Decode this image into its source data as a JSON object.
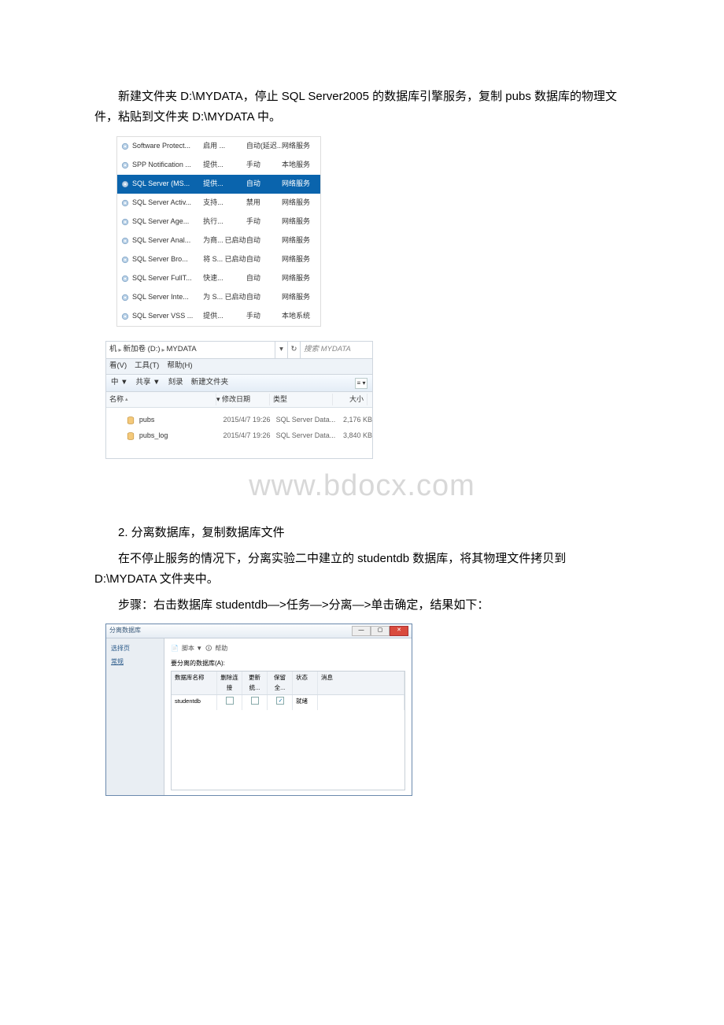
{
  "paragraphs": {
    "p1": "新建文件夹 D:\\MYDATA，停止 SQL Server2005 的数据库引擎服务，复制 pubs 数据库的物理文件，粘贴到文件夹 D:\\MYDATA 中。",
    "p2": "2. 分离数据库，复制数据库文件",
    "p3": "在不停止服务的情况下，分离实验二中建立的 studentdb 数据库，将其物理文件拷贝到 D:\\MYDATA 文件夹中。",
    "p4": "步骤：右击数据库 studentdb—>任务—>分离—>单击确定，结果如下："
  },
  "watermark": "www.bdocx.com",
  "services": [
    {
      "name": "Software Protect...",
      "desc": "启用 ...",
      "status": "",
      "startup": "自动(延迟...",
      "logon": "网络服务",
      "sel": false
    },
    {
      "name": "SPP Notification ...",
      "desc": "提供...",
      "status": "",
      "startup": "手动",
      "logon": "本地服务",
      "sel": false
    },
    {
      "name": "SQL Server (MS...",
      "desc": "提供...",
      "status": "",
      "startup": "自动",
      "logon": "网络服务",
      "sel": true
    },
    {
      "name": "SQL Server Activ...",
      "desc": "支持...",
      "status": "",
      "startup": "禁用",
      "logon": "网络服务",
      "sel": false
    },
    {
      "name": "SQL Server Age...",
      "desc": "执行...",
      "status": "",
      "startup": "手动",
      "logon": "网络服务",
      "sel": false
    },
    {
      "name": "SQL Server Anal...",
      "desc": "为商...",
      "status": "已启动",
      "startup": "自动",
      "logon": "网络服务",
      "sel": false
    },
    {
      "name": "SQL Server Bro...",
      "desc": "将 S...",
      "status": "已启动",
      "startup": "自动",
      "logon": "网络服务",
      "sel": false
    },
    {
      "name": "SQL Server FullT...",
      "desc": "快速...",
      "status": "",
      "startup": "自动",
      "logon": "网络服务",
      "sel": false
    },
    {
      "name": "SQL Server Inte...",
      "desc": "为 S...",
      "status": "已启动",
      "startup": "自动",
      "logon": "网络服务",
      "sel": false
    },
    {
      "name": "SQL Server VSS ...",
      "desc": "提供...",
      "status": "",
      "startup": "手动",
      "logon": "本地系统",
      "sel": false
    }
  ],
  "explorer": {
    "path_seg1": "机",
    "path_seg2": "新加卷 (D:)",
    "path_seg3": "MYDATA",
    "search_placeholder": "搜索 MYDATA",
    "menu": {
      "view": "看(V)",
      "tools": "工具(T)",
      "help": "帮助(H)"
    },
    "toolbar": {
      "lib": "中 ▼",
      "share": "共享 ▼",
      "burn": "刻录",
      "newfolder": "新建文件夹"
    },
    "columns": {
      "name": "名称",
      "date": "修改日期",
      "type": "类型",
      "size": "大小"
    },
    "files": [
      {
        "name": "pubs",
        "date": "2015/4/7 19:26",
        "type": "SQL Server Data...",
        "size": "2,176 KB"
      },
      {
        "name": "pubs_log",
        "date": "2015/4/7 19:26",
        "type": "SQL Server Data...",
        "size": "3,840 KB"
      }
    ]
  },
  "dialog": {
    "title": "分离数据库",
    "nav": {
      "select": "选择页",
      "general": "常规"
    },
    "toolbar": {
      "script": "脚本 ▼",
      "help": "帮助"
    },
    "grid_label": "要分离的数据库(A):",
    "headers": {
      "name": "数据库名称",
      "drop": "删除连接",
      "update": "更新统...",
      "keep": "保留全...",
      "status": "状态",
      "msg": "消息"
    },
    "row": {
      "name": "studentdb",
      "status": "就绪"
    }
  }
}
